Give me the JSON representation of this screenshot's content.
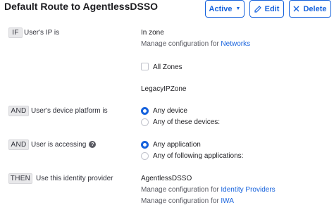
{
  "header": {
    "title": "Default Route to AgentlessDSSO"
  },
  "toolbar": {
    "active_label": "Active",
    "edit_label": "Edit",
    "delete_label": "Delete"
  },
  "rules": {
    "if": {
      "tag": "IF",
      "label": "User's IP is",
      "value": "In zone",
      "manage_text": "Manage configuration for ",
      "manage_link": "Networks",
      "all_zones_label": "All Zones",
      "zone": "LegacyIPZone"
    },
    "platform": {
      "tag": "AND",
      "label": "User's device platform is",
      "options": [
        "Any device",
        "Any of these devices:"
      ],
      "selected": 0
    },
    "accessing": {
      "tag": "AND",
      "label": "User is accessing",
      "help": "?",
      "options": [
        "Any application",
        "Any of following applications:"
      ],
      "selected": 0
    },
    "then": {
      "tag": "THEN",
      "label": "Use this identity provider",
      "value": "AgentlessDSSO",
      "manage_text": "Manage configuration for ",
      "manage_link_1": "Identity Providers",
      "manage_link_2": "IWA"
    }
  },
  "colors": {
    "accent": "#1662dd",
    "tag_bg": "#e8e8ea"
  }
}
